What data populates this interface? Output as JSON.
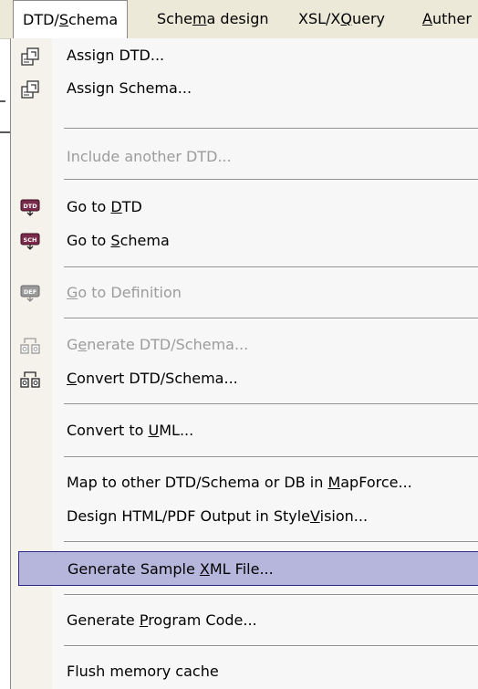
{
  "menubar": {
    "items": [
      {
        "pre": "DTD/",
        "ul": "S",
        "post": "chema",
        "active": true
      },
      {
        "pre": "Sche",
        "ul": "m",
        "post": "a design"
      },
      {
        "pre": "XSL/X",
        "ul": "Q",
        "post": "uery"
      },
      {
        "pre": "",
        "ul": "A",
        "post": "uther"
      }
    ]
  },
  "menu": {
    "items": [
      {
        "pre": "Assign DTD...",
        "ul": "",
        "post": "",
        "icon": "assign-dtd-icon"
      },
      {
        "pre": "Assign Schema...",
        "ul": "",
        "post": "",
        "icon": "assign-schema-icon"
      },
      {
        "pre": "Include another DTD...",
        "ul": "",
        "post": "",
        "disabled": true
      },
      {
        "pre": "Go to ",
        "ul": "D",
        "post": "TD",
        "icon": "dtd-icon"
      },
      {
        "pre": "Go to ",
        "ul": "S",
        "post": "chema",
        "icon": "sch-icon"
      },
      {
        "pre": "",
        "ul": "G",
        "post": "o to Definition",
        "icon": "def-icon",
        "disabled": true
      },
      {
        "pre": "G",
        "ul": "e",
        "post": "nerate DTD/Schema...",
        "icon": "generate-icon",
        "disabled": true
      },
      {
        "pre": "",
        "ul": "C",
        "post": "onvert DTD/Schema...",
        "icon": "convert-icon"
      },
      {
        "pre": "Convert to ",
        "ul": "U",
        "post": "ML..."
      },
      {
        "pre": "Map to other DTD/Schema or DB in ",
        "ul": "M",
        "post": "apForce..."
      },
      {
        "pre": "Design HTML/PDF Output in Style",
        "ul": "V",
        "post": "ision..."
      },
      {
        "pre": "Generate Sample ",
        "ul": "X",
        "post": "ML File...",
        "highlight": true
      },
      {
        "pre": "Generate ",
        "ul": "P",
        "post": "rogram Code..."
      },
      {
        "pre": "Flush memory cache",
        "ul": "",
        "post": ""
      }
    ]
  },
  "colors": {
    "menubar_bg": "#ece9d8",
    "highlight_bg": "#b6b6dc",
    "highlight_border": "#2c2a86",
    "disabled_text": "#9c9c9c"
  }
}
